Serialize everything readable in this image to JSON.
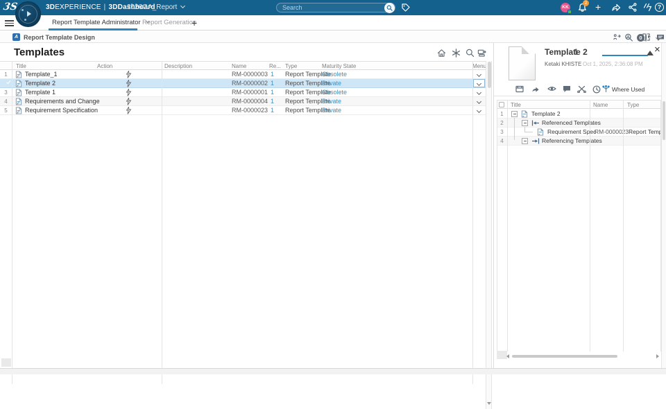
{
  "colors": {
    "topbar_bg": "#15618d",
    "accent_blue": "#2e86c1",
    "link_blue": "#3f8fc0",
    "selected_row_bg": "#cfe6f7",
    "avatar_pink": "#e8558b",
    "notification_badge_orange": "#f29b38",
    "presence_green": "#55b955"
  },
  "icons": {
    "add": "+",
    "help": "?",
    "close": "×",
    "info": "i",
    "play": "triangle",
    "hamburger": "menu-bars",
    "search": "magnifier",
    "tag": "label-outline",
    "bell": "notifications",
    "share-forward": "arrow",
    "share-nodes": "network"
  },
  "topbar": {
    "brand_3d": "3D",
    "brand_rest": "EXPERIENCE",
    "separator": "|",
    "app_name": "3DDashboard",
    "context_name": "2026GA_Report",
    "search_placeholder": "Search",
    "notification_count": "2",
    "avatar_initials": "KK",
    "help_glyph": "?",
    "add_glyph": "+"
  },
  "tabbar": {
    "tabs": [
      {
        "label": "Report Template Administrator",
        "active": true
      },
      {
        "label": "Report Generation",
        "active": false
      }
    ],
    "add_tab_glyph": "+",
    "info_glyph": "0"
  },
  "appbar": {
    "title": "Report Template Design",
    "app_icon_glyph": "A"
  },
  "templates": {
    "title": "Templates",
    "columns": {
      "title": "Title",
      "action": "Action",
      "description": "Description",
      "name": "Name",
      "revision": "Re...",
      "type": "Type",
      "maturity": "Maturity State",
      "menu": "Menu"
    },
    "rows": [
      {
        "num": "1",
        "title": "Template_1",
        "name": "RM-0000003",
        "revision": "1",
        "type": "Report Template",
        "maturity": "Obsolete",
        "selected": false
      },
      {
        "num": "2",
        "title": "Template 2",
        "name": "RM-0000002",
        "revision": "1",
        "type": "Report Template",
        "maturity": "Private",
        "selected": true
      },
      {
        "num": "3",
        "title": "Template 1",
        "name": "RM-0000001",
        "revision": "1",
        "type": "Report Template",
        "maturity": "Obsolete",
        "selected": false
      },
      {
        "num": "4",
        "title": "Requirements and Change",
        "name": "RM-0000004",
        "revision": "1",
        "type": "Report Template",
        "maturity": "Private",
        "selected": false
      },
      {
        "num": "5",
        "title": "Requirement Specification",
        "name": "RM-0000023",
        "revision": "1",
        "type": "Report Template",
        "maturity": "Private",
        "selected": false
      }
    ]
  },
  "detail": {
    "title": "Template 2",
    "revision": "1",
    "owner": "Ketaki KHISTE",
    "modified": "Oct 1, 2025, 2:36:08 PM",
    "close_glyph": "×",
    "where_used_label": "Where Used",
    "columns": {
      "title": "Title",
      "name": "Name",
      "type": "Type"
    },
    "tree": [
      {
        "num": "1",
        "title": "Template 2",
        "level": 0,
        "icon": "report-template"
      },
      {
        "num": "2",
        "title": "Referenced Templates",
        "level": 1,
        "icon": "referenced-arrow"
      },
      {
        "num": "3",
        "title": "Requirement Specific...",
        "level": 2,
        "icon": "report-template",
        "name": "RM-0000023",
        "type": "Report Template"
      },
      {
        "num": "4",
        "title": "Referencing Templates",
        "level": 1,
        "icon": "referencing-arrow"
      }
    ]
  }
}
